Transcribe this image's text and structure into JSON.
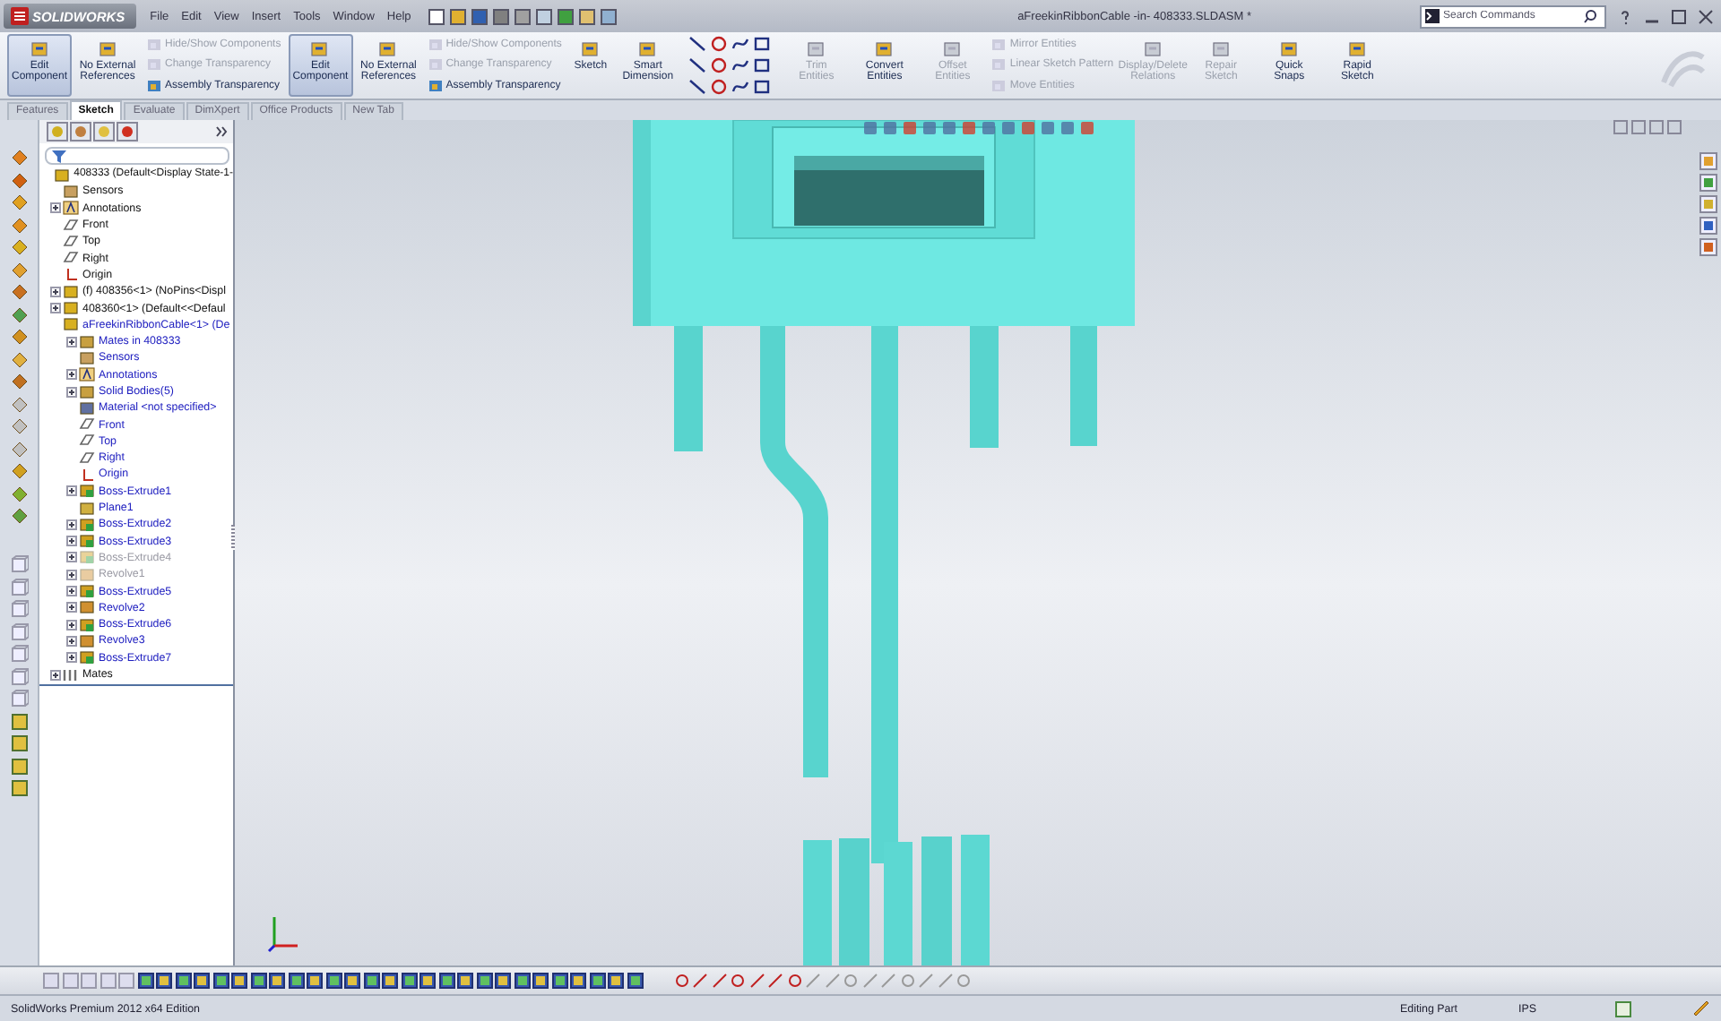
{
  "title_bar": {
    "logo": "SOLIDWORKS",
    "menu": [
      "File",
      "Edit",
      "View",
      "Insert",
      "Tools",
      "Window",
      "Help"
    ],
    "document_title": "aFreekinRibbonCable -in- 408333.SLDASM *",
    "search": {
      "placeholder": "Search Commands"
    }
  },
  "ribbon": [
    {
      "kind": "large",
      "label": "Edit Component",
      "selected": true,
      "disabled": false
    },
    {
      "kind": "large",
      "label": "No External References",
      "selected": false,
      "disabled": false
    },
    {
      "kind": "stack",
      "entries": [
        {
          "label": "Hide/Show Components",
          "disabled": true
        },
        {
          "label": "Change Transparency",
          "disabled": true
        },
        {
          "label": "Assembly Transparency",
          "disabled": false
        }
      ]
    },
    {
      "kind": "large",
      "label": "Edit Component",
      "selected": true,
      "disabled": false
    },
    {
      "kind": "large",
      "label": "No External References",
      "selected": false,
      "disabled": false
    },
    {
      "kind": "stack",
      "entries": [
        {
          "label": "Hide/Show Components",
          "disabled": true
        },
        {
          "label": "Change Transparency",
          "disabled": true
        },
        {
          "label": "Assembly Transparency",
          "disabled": false
        }
      ]
    },
    {
      "kind": "large",
      "label": "Sketch",
      "selected": false,
      "disabled": false
    },
    {
      "kind": "large",
      "label": "Smart Dimension",
      "selected": false,
      "disabled": false
    },
    {
      "kind": "sketch_tools"
    },
    {
      "kind": "large",
      "label": "Trim Entities",
      "selected": false,
      "disabled": true
    },
    {
      "kind": "large",
      "label": "Convert Entities",
      "selected": false,
      "disabled": false
    },
    {
      "kind": "large",
      "label": "Offset Entities",
      "selected": false,
      "disabled": true
    },
    {
      "kind": "stack",
      "entries": [
        {
          "label": "Mirror Entities",
          "disabled": true
        },
        {
          "label": "Linear Sketch Pattern",
          "disabled": true
        },
        {
          "label": "Move Entities",
          "disabled": true
        }
      ]
    },
    {
      "kind": "large",
      "label": "Display/Delete Relations",
      "selected": false,
      "disabled": true
    },
    {
      "kind": "large",
      "label": "Repair Sketch",
      "selected": false,
      "disabled": true
    },
    {
      "kind": "large",
      "label": "Quick Snaps",
      "selected": false,
      "disabled": false
    },
    {
      "kind": "large",
      "label": "Rapid Sketch",
      "selected": false,
      "disabled": false
    }
  ],
  "tabs": [
    {
      "label": "Features",
      "selected": false
    },
    {
      "label": "Sketch",
      "selected": true
    },
    {
      "label": "Evaluate",
      "selected": false
    },
    {
      "label": "DimXpert",
      "selected": false
    },
    {
      "label": "Office Products",
      "selected": false
    },
    {
      "label": "New Tab",
      "selected": false
    }
  ],
  "tree": [
    {
      "label": "408333  (Default<Display State-1-",
      "kind": "assembly",
      "children": [
        {
          "label": "Sensors",
          "kind": "sensors"
        },
        {
          "label": "Annotations",
          "kind": "annotations",
          "expanded": false
        },
        {
          "label": "Front",
          "kind": "plane"
        },
        {
          "label": "Top",
          "kind": "plane"
        },
        {
          "label": "Right",
          "kind": "plane"
        },
        {
          "label": "Origin",
          "kind": "origin"
        },
        {
          "label": "(f) 408356<1> (NoPins<Displ",
          "kind": "part",
          "expanded": false
        },
        {
          "label": "408360<1> (Default<<Defaul",
          "kind": "part",
          "expanded": false
        },
        {
          "label": "aFreekinRibbonCable<1> (De",
          "kind": "part",
          "editing": true,
          "children": [
            {
              "label": "Mates in 408333",
              "kind": "folder",
              "expanded": false
            },
            {
              "label": "Sensors",
              "kind": "sensors"
            },
            {
              "label": "Annotations",
              "kind": "annotations",
              "expanded": false
            },
            {
              "label": "Solid Bodies(5)",
              "kind": "folder",
              "expanded": false
            },
            {
              "label": "Material <not specified>",
              "kind": "material"
            },
            {
              "label": "Front",
              "kind": "plane"
            },
            {
              "label": "Top",
              "kind": "plane"
            },
            {
              "label": "Right",
              "kind": "plane"
            },
            {
              "label": "Origin",
              "kind": "origin"
            },
            {
              "label": "Boss-Extrude1",
              "kind": "feature",
              "expanded": false,
              "suppressed": false
            },
            {
              "label": "Plane1",
              "kind": "refplane"
            },
            {
              "label": "Boss-Extrude2",
              "kind": "feature",
              "expanded": false,
              "suppressed": false
            },
            {
              "label": "Boss-Extrude3",
              "kind": "feature",
              "expanded": false,
              "suppressed": false
            },
            {
              "label": "Boss-Extrude4",
              "kind": "feature",
              "expanded": false,
              "suppressed": true
            },
            {
              "label": "Revolve1",
              "kind": "revolve",
              "expanded": false,
              "suppressed": true
            },
            {
              "label": "Boss-Extrude5",
              "kind": "feature",
              "expanded": false,
              "suppressed": false
            },
            {
              "label": "Revolve2",
              "kind": "revolve",
              "expanded": false,
              "suppressed": false
            },
            {
              "label": "Boss-Extrude6",
              "kind": "feature",
              "expanded": false,
              "suppressed": false
            },
            {
              "label": "Revolve3",
              "kind": "revolve",
              "expanded": false,
              "suppressed": false
            },
            {
              "label": "Boss-Extrude7",
              "kind": "feature",
              "expanded": false,
              "suppressed": false
            }
          ]
        },
        {
          "label": "Mates",
          "kind": "mates",
          "expanded": false
        }
      ]
    }
  ],
  "status_bar": [
    "SolidWorks Premium 2012 x64 Edition",
    "Editing Part",
    "IPS"
  ]
}
